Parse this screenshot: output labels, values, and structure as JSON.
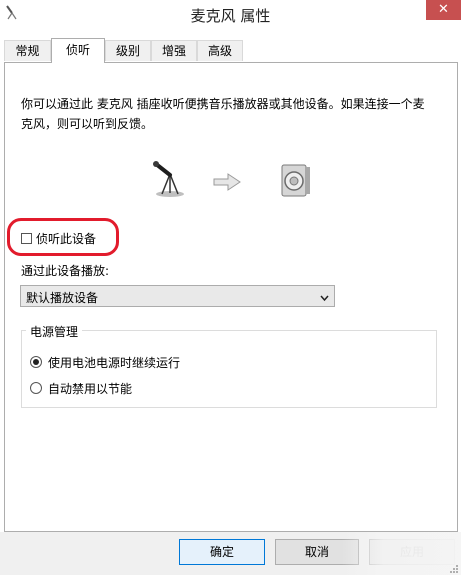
{
  "window": {
    "title": "麦克风 属性",
    "close_glyph": "✕"
  },
  "tabs": [
    {
      "label": "常规"
    },
    {
      "label": "侦听",
      "active": true
    },
    {
      "label": "级别"
    },
    {
      "label": "增强"
    },
    {
      "label": "高级"
    }
  ],
  "listen_tab": {
    "description": "你可以通过此 麦克风 插座收听便携音乐播放器或其他设备。如果连接一个麦克风，则可以听到反馈。",
    "listen_checkbox_label": "侦听此设备",
    "listen_checked": false,
    "play_through_label": "通过此设备播放:",
    "play_device_value": "默认播放设备",
    "power_group_title": "电源管理",
    "power_options": [
      {
        "label": "使用电池电源时继续运行",
        "checked": true
      },
      {
        "label": "自动禁用以节能",
        "checked": false
      }
    ]
  },
  "footer": {
    "ok_label": "确定",
    "cancel_label": "取消",
    "apply_label": "应用"
  },
  "icons": {
    "app": "microphone-settings-icon",
    "source": "microphone-icon",
    "direction": "arrow-right-icon",
    "target": "speaker-icon"
  },
  "colors": {
    "highlight": "#e21b2c",
    "close_button": "#c75050",
    "focus_border": "#0078d7"
  }
}
